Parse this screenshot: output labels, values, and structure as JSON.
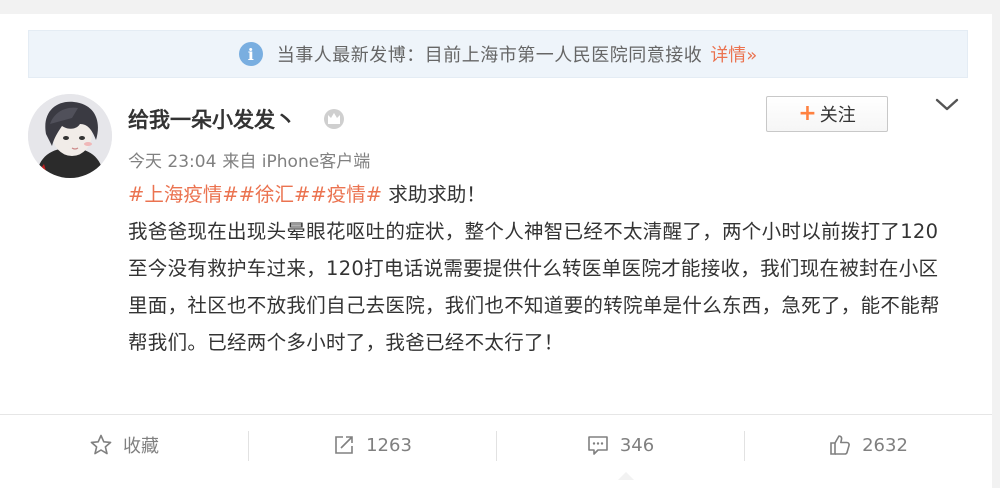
{
  "notice": {
    "icon": "info-icon",
    "text": "当事人最新发博：目前上海市第一人民医院同意接收",
    "link": "详情»"
  },
  "post": {
    "author": "给我一朵小发发丶",
    "badge_icon": "crown-icon",
    "time": "今天 23:04",
    "source": "来自 iPhone客户端",
    "follow_label": "关注",
    "tags": [
      "#上海疫情#",
      "#徐汇#",
      "#疫情#"
    ],
    "tag_suffix": " 求助求助！",
    "body": "我爸爸现在出现头晕眼花呕吐的症状，整个人神智已经不太清醒了，两个小时以前拨打了120至今没有救护车过来，120打电话说需要提供什么转医单医院才能接收，我们现在被封在小区里面，社区也不放我们自己去医院，我们也不知道要的转院单是什么东西，急死了，能不能帮帮我们。已经两个多小时了，我爸已经不太行了！"
  },
  "actions": {
    "favorite": "收藏",
    "repost": "1263",
    "comment": "346",
    "like": "2632"
  },
  "colors": {
    "accent": "#eb7350",
    "notice_bg": "#eef4fa",
    "meta": "#808080"
  }
}
